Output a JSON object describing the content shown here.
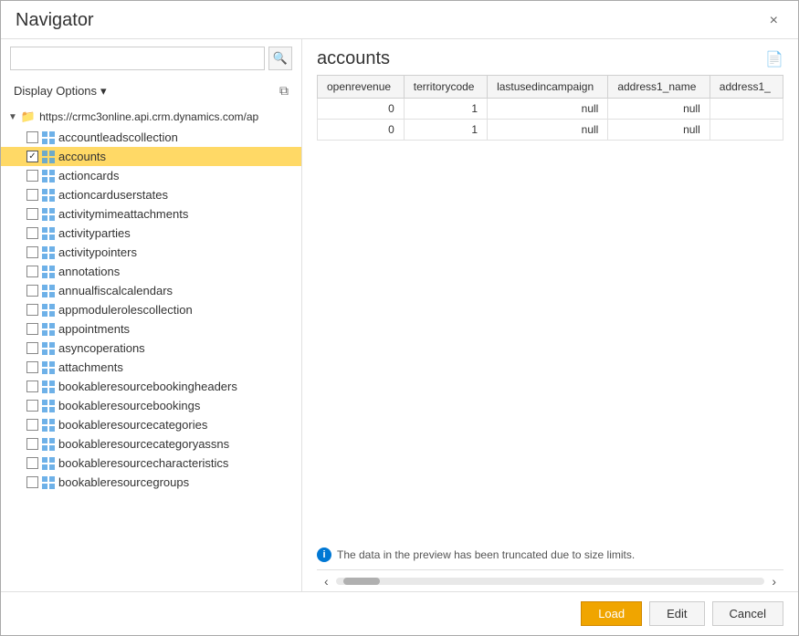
{
  "dialog": {
    "title": "Navigator",
    "close_label": "×"
  },
  "left_panel": {
    "search_placeholder": "",
    "search_icon": "🔍",
    "display_options_label": "Display Options",
    "display_options_arrow": "▾",
    "refresh_icon": "⧉",
    "tree": {
      "root_label": "https://crmc3online.api.crm.dynamics.com/ap",
      "items": [
        {
          "label": "accountleadscollection",
          "checked": false,
          "selected": false
        },
        {
          "label": "accounts",
          "checked": true,
          "selected": true
        },
        {
          "label": "actioncards",
          "checked": false,
          "selected": false
        },
        {
          "label": "actioncarduserstates",
          "checked": false,
          "selected": false
        },
        {
          "label": "activitymimeattachments",
          "checked": false,
          "selected": false
        },
        {
          "label": "activityparties",
          "checked": false,
          "selected": false
        },
        {
          "label": "activitypointers",
          "checked": false,
          "selected": false
        },
        {
          "label": "annotations",
          "checked": false,
          "selected": false
        },
        {
          "label": "annualfiscalcalendars",
          "checked": false,
          "selected": false
        },
        {
          "label": "appmodulerolescollection",
          "checked": false,
          "selected": false
        },
        {
          "label": "appointments",
          "checked": false,
          "selected": false
        },
        {
          "label": "asyncoperations",
          "checked": false,
          "selected": false
        },
        {
          "label": "attachments",
          "checked": false,
          "selected": false
        },
        {
          "label": "bookableresourcebookingheaders",
          "checked": false,
          "selected": false
        },
        {
          "label": "bookableresourcebookings",
          "checked": false,
          "selected": false
        },
        {
          "label": "bookableresourcecategories",
          "checked": false,
          "selected": false
        },
        {
          "label": "bookableresourcecategoryassns",
          "checked": false,
          "selected": false
        },
        {
          "label": "bookableresourcecharacteristics",
          "checked": false,
          "selected": false
        },
        {
          "label": "bookableresourcegroups",
          "checked": false,
          "selected": false
        }
      ]
    }
  },
  "right_panel": {
    "title": "accounts",
    "export_icon": "📄",
    "table": {
      "columns": [
        "openrevenue",
        "territorycode",
        "lastusedincampaign",
        "address1_name",
        "address1_"
      ],
      "rows": [
        [
          "0",
          "1",
          "null",
          "null",
          ""
        ],
        [
          "0",
          "1",
          "null",
          "null",
          ""
        ]
      ]
    },
    "truncation_notice": "The data in the preview has been truncated due to size limits."
  },
  "footer": {
    "load_label": "Load",
    "edit_label": "Edit",
    "cancel_label": "Cancel"
  }
}
